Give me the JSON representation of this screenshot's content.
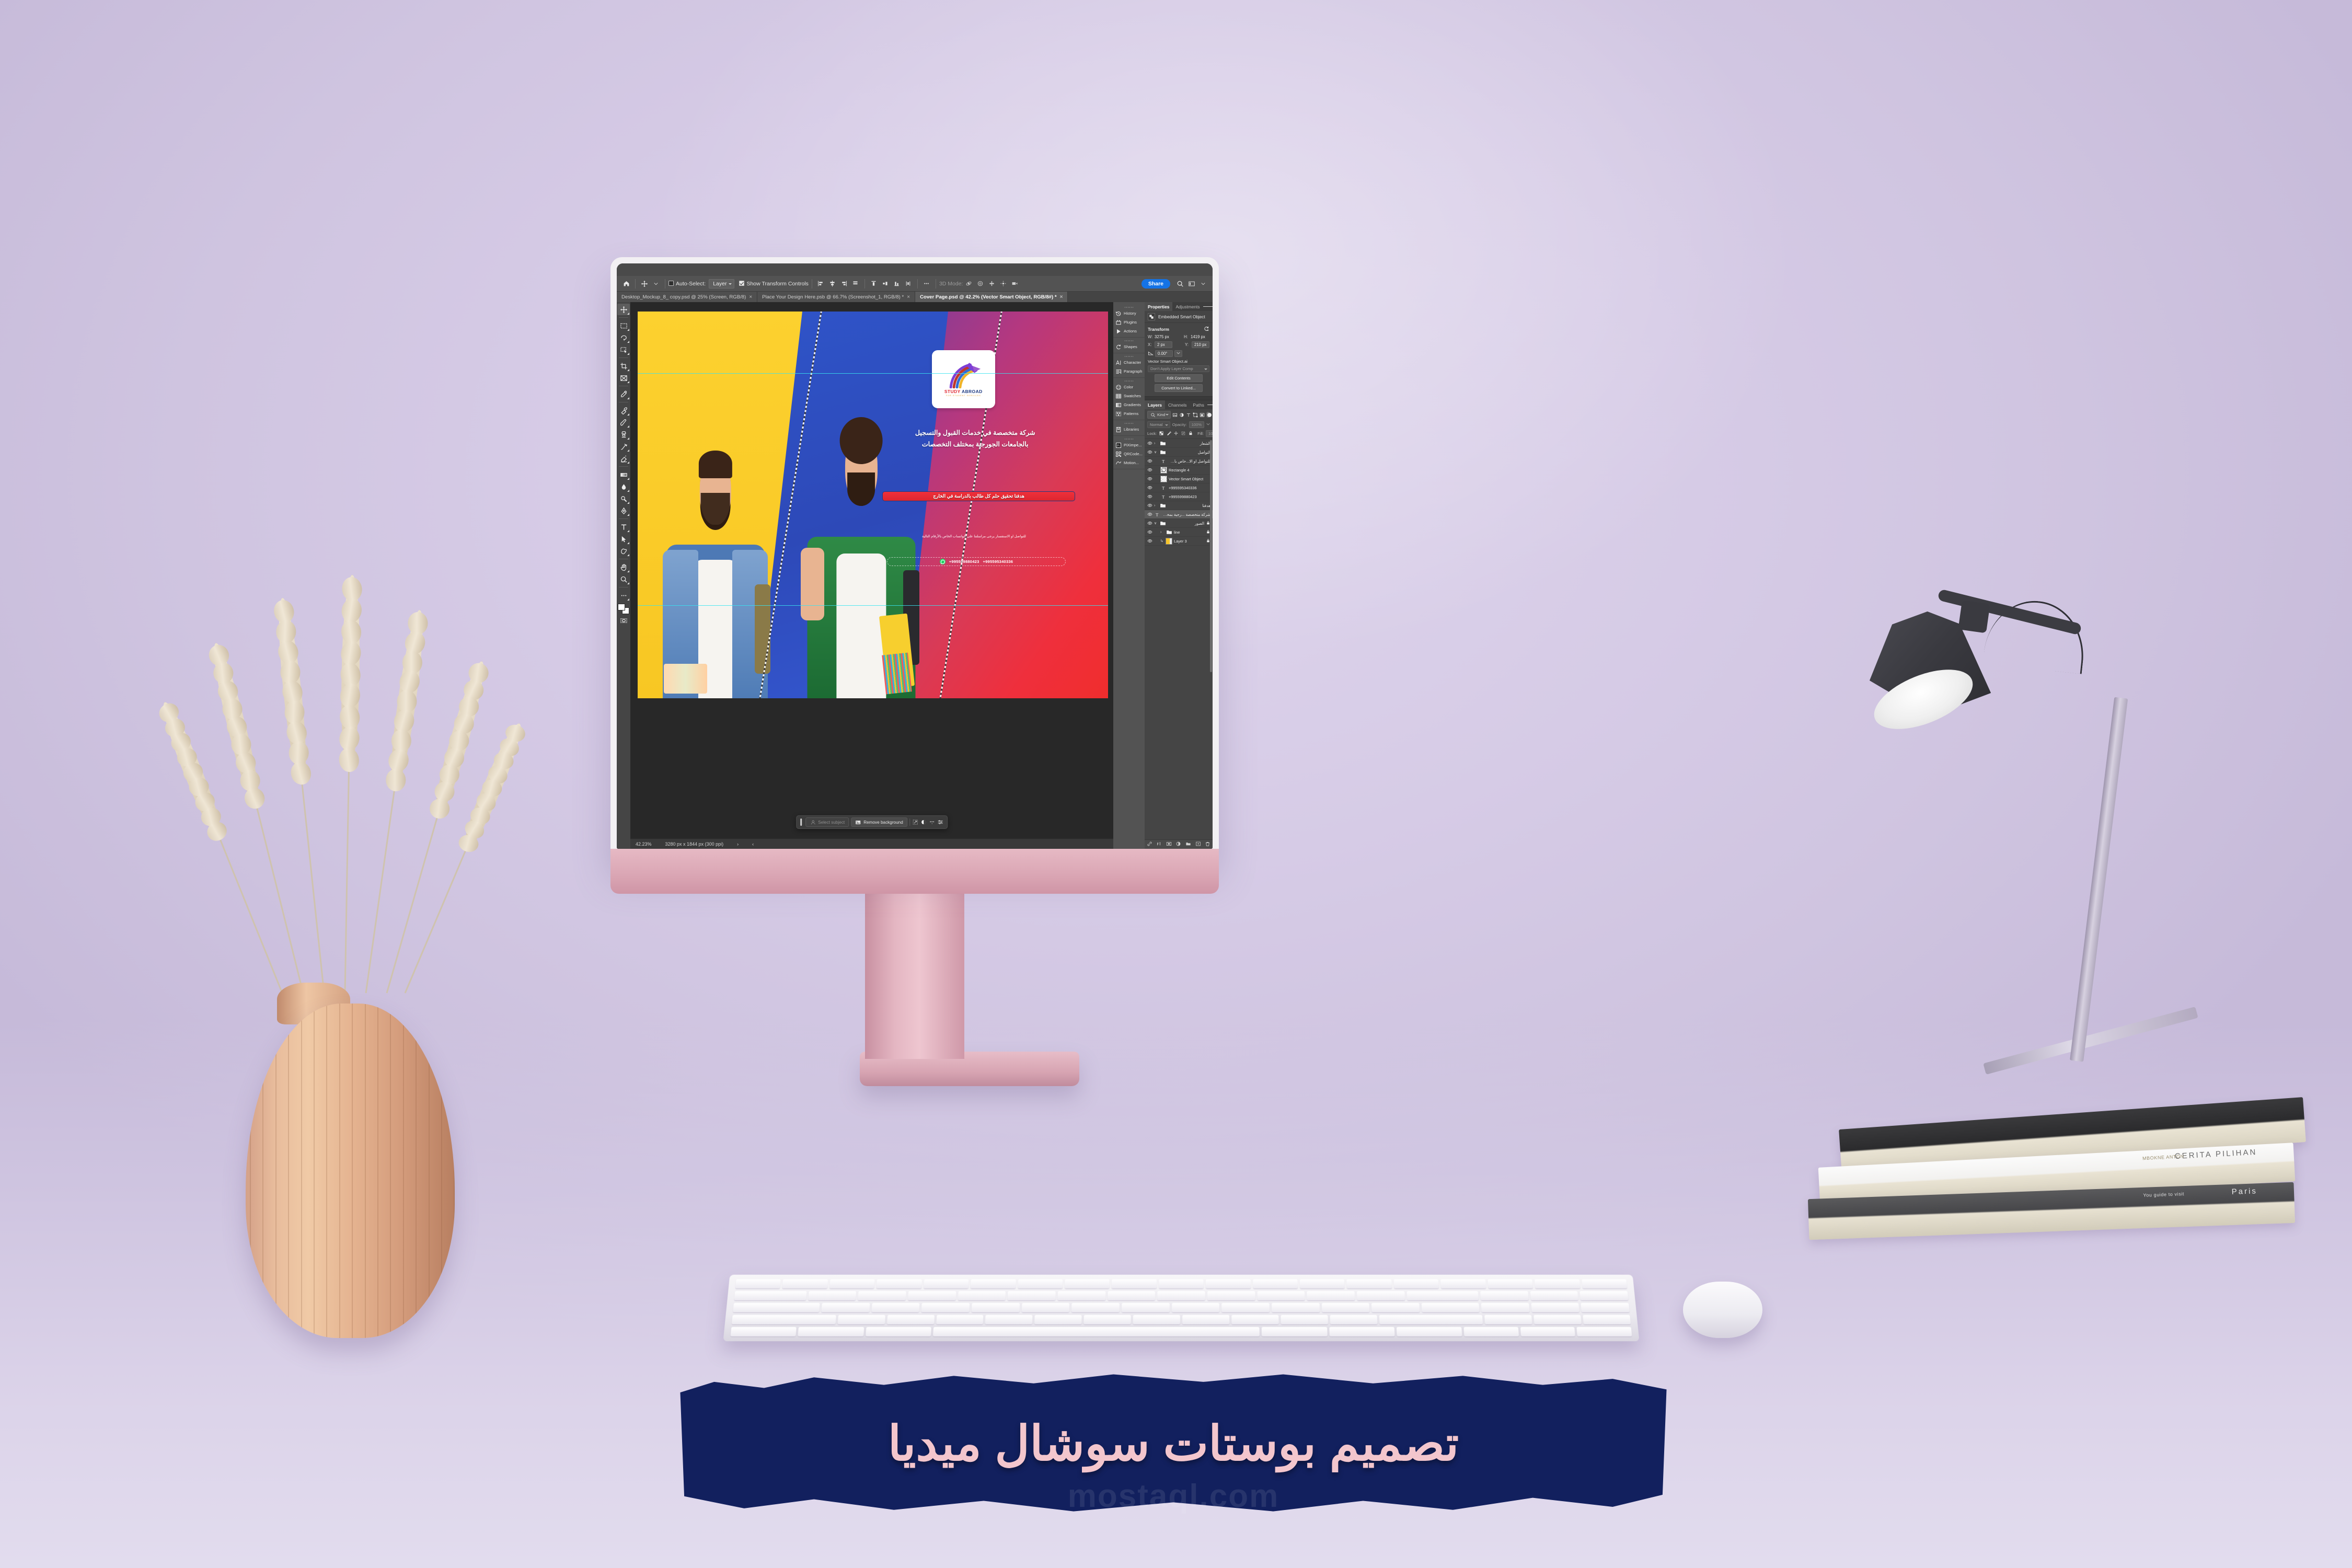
{
  "scene": {
    "background_color": "#d6cbe6",
    "description_objects": [
      "monitor",
      "keyboard",
      "mouse",
      "vase-with-wheat",
      "desk-lamp",
      "book-stack"
    ]
  },
  "app": {
    "name": "Adobe Photoshop",
    "share_label": "Share"
  },
  "options_bar": {
    "home_icon": "home-icon",
    "tool_icon": "move-tool-icon",
    "auto_select_label": "Auto-Select:",
    "auto_select_checked": false,
    "layer_select_value": "Layer",
    "show_transform_label": "Show Transform Controls",
    "show_transform_checked": true,
    "three_d_mode_label": "3D Mode:",
    "align_icons": [
      "align-left-edges-icon",
      "align-horizontal-centers-icon",
      "align-right-edges-icon",
      "align-top-edges-icon",
      "distribute-top-icon",
      "distribute-vertical-centers-icon",
      "distribute-bottom-icon",
      "distribute-horizontal-icon"
    ],
    "more_icon": "ellipsis-icon",
    "three_d_icons": [
      "orbit-3d-icon",
      "roll-3d-icon",
      "pan-3d-icon",
      "slide-3d-icon",
      "camera-3d-icon"
    ],
    "search_icon": "search-icon",
    "workspace_icon": "workspace-switcher-icon"
  },
  "document_tabs": [
    {
      "label": "Desktop_Mockup_8_ copy.psd @ 25% (Screen, RGB/8)",
      "active": false,
      "close": "×"
    },
    {
      "label": "Place Your Design Here.psb @ 66.7% (Screenshot_1, RGB/8) *",
      "active": false,
      "close": "×"
    },
    {
      "label": "Cover Page.psd @ 42.2% (Vector Smart Object, RGB/8#) *",
      "active": true,
      "close": "×"
    }
  ],
  "toolbar": {
    "tools": [
      {
        "name": "move-tool",
        "selected": true
      },
      {
        "name": "rectangular-marquee-tool",
        "selected": false
      },
      {
        "name": "lasso-tool",
        "selected": false
      },
      {
        "name": "object-selection-tool",
        "selected": false
      },
      {
        "name": "crop-tool",
        "selected": false
      },
      {
        "name": "frame-tool",
        "selected": false
      },
      {
        "name": "eyedropper-tool",
        "selected": false
      },
      {
        "name": "spot-healing-brush-tool",
        "selected": false
      },
      {
        "name": "brush-tool",
        "selected": false
      },
      {
        "name": "clone-stamp-tool",
        "selected": false
      },
      {
        "name": "history-brush-tool",
        "selected": false
      },
      {
        "name": "eraser-tool",
        "selected": false
      },
      {
        "name": "gradient-tool",
        "selected": false
      },
      {
        "name": "blur-tool",
        "selected": false
      },
      {
        "name": "dodge-tool",
        "selected": false
      },
      {
        "name": "pen-tool",
        "selected": false
      },
      {
        "name": "type-tool",
        "selected": false
      },
      {
        "name": "path-selection-tool",
        "selected": false
      },
      {
        "name": "shape-tool",
        "selected": false
      },
      {
        "name": "hand-tool",
        "selected": false
      },
      {
        "name": "zoom-tool",
        "selected": false
      },
      {
        "name": "edit-toolbar-tool",
        "selected": false
      }
    ],
    "foreground_color": "#ffffff",
    "background_color": "#ffffff",
    "quick_mask_label": "quick-mask-icon"
  },
  "canvas": {
    "poster": {
      "panel_colors": [
        "#fbcf2d",
        "#2f50c4",
        "#ef3040"
      ],
      "students": [
        "student-with-books",
        "student-with-notebooks"
      ],
      "logo": {
        "name": "STUDY ABROAD",
        "word_1": "STUDY",
        "word_2": "ABROAD",
        "tagline": "FOR STUDENT SERVICES",
        "word_1_color": "#e02a33",
        "word_2_color": "#1f3a80"
      },
      "headline_line_1": "شركة متخصصة في خدمات القبول والتسجيل",
      "headline_line_2": "بالجامعات الجورجية بمختلف التخصصات",
      "cta_button": "هدفنا تحقيق حلم كل طالب بالدراسة في الخارج",
      "cta_bg_color": "#e62b35",
      "cta_border_color": "#1f3a80",
      "contact_line": "للتواصل او الاستفسار يرجى مراسلتنا على الواتساب الخاص بالأرقام التالية",
      "whatsapp_icon": "whatsapp-icon",
      "phone_1": "+995599880423",
      "phone_2": "+995595340336"
    }
  },
  "contextual_taskbar": {
    "select_subject_label": "Select subject",
    "select_subject_icon": "person-select-icon",
    "remove_background_label": "Remove background",
    "remove_background_icon": "image-icon",
    "transform_icon": "transform-selection-icon",
    "adjustment_icon": "adjustment-layer-icon",
    "more_icon": "ellipsis-icon",
    "properties_icon": "sliders-icon"
  },
  "status_bar": {
    "zoom": "42.23%",
    "doc_size": "3280 px x 1844 px (300 ppi)",
    "next_arrow": "›",
    "prev_arrow": "‹"
  },
  "panel_rail": {
    "groups": [
      {
        "items": [
          {
            "label": "History",
            "icon": "history-icon"
          },
          {
            "label": "Plugins",
            "icon": "plugins-icon"
          },
          {
            "label": "Actions",
            "icon": "actions-play-icon"
          }
        ]
      },
      {
        "items": [
          {
            "label": "Shapes",
            "icon": "shapes-icon"
          }
        ]
      },
      {
        "items": [
          {
            "label": "Character",
            "icon": "character-icon"
          },
          {
            "label": "Paragraph",
            "icon": "paragraph-icon"
          }
        ]
      },
      {
        "items": [
          {
            "label": "Color",
            "icon": "color-wheel-icon"
          },
          {
            "label": "Swatches",
            "icon": "swatches-icon"
          },
          {
            "label": "Gradients",
            "icon": "gradients-icon"
          },
          {
            "label": "Patterns",
            "icon": "patterns-icon"
          }
        ]
      },
      {
        "items": [
          {
            "label": "Libraries",
            "icon": "libraries-icon"
          }
        ]
      },
      {
        "items": [
          {
            "label": "PiXimpe...",
            "icon": "piximperfect-icon"
          },
          {
            "label": "QRCode...",
            "icon": "qrcode-icon"
          },
          {
            "label": "Motion...",
            "icon": "motion-icon"
          }
        ]
      }
    ]
  },
  "properties_panel": {
    "tabs": [
      {
        "label": "Properties",
        "active": true
      },
      {
        "label": "Adjustments",
        "active": false
      }
    ],
    "object_type": "Embedded Smart Object",
    "object_icon": "smart-object-icon",
    "transform_title": "Transform",
    "reset_icon": "reset-icon",
    "w_label": "W:",
    "w_value": "3275 px",
    "h_label": "H:",
    "h_value": "1419 px",
    "x_label": "X:",
    "x_value": "2 px",
    "y_label": "Y:",
    "y_value": "210 px",
    "angle_icon": "angle-icon",
    "angle_value": "0.00°",
    "source_file": "Vector Smart Object.ai",
    "layer_comp_value": "Don't Apply Layer Comp",
    "edit_contents_label": "Edit Contents",
    "convert_to_linked_label": "Convert to Linked..."
  },
  "layers_panel": {
    "tabs": [
      {
        "label": "Layers",
        "active": true
      },
      {
        "label": "Channels",
        "active": false
      },
      {
        "label": "Paths",
        "active": false
      }
    ],
    "filter_label": "Kind",
    "filter_icon": "search-icon",
    "filter_type_icons": [
      "pixel-filter-icon",
      "adjustment-filter-icon",
      "type-filter-icon",
      "shape-filter-icon",
      "smart-object-filter-icon"
    ],
    "filter_toggle": "filter-enable-toggle",
    "blend_mode": "Normal",
    "opacity_label": "Opacity:",
    "opacity_value": "100%",
    "lock_label": "Lock:",
    "lock_icons": [
      "lock-transparency-icon",
      "lock-image-icon",
      "lock-position-icon",
      "lock-artboard-icon",
      "lock-all-icon"
    ],
    "fill_label": "Fill:",
    "fill_value": "100%",
    "rows": [
      {
        "name": "الشعار",
        "type": "group",
        "rtl": true,
        "expanded": false,
        "indent": 0,
        "locked": false,
        "selected": false
      },
      {
        "name": "التواصل",
        "type": "group",
        "rtl": true,
        "expanded": true,
        "indent": 0,
        "locked": false,
        "selected": false
      },
      {
        "name": "للتواصل او الا...خاص بالأرقام",
        "type": "text",
        "rtl": true,
        "indent": 1,
        "locked": false,
        "selected": false
      },
      {
        "name": "Rectangle 4",
        "type": "shape",
        "rtl": false,
        "indent": 1,
        "locked": false,
        "selected": false
      },
      {
        "name": "Vector Smart Object",
        "type": "smart",
        "rtl": false,
        "indent": 1,
        "locked": false,
        "selected": false
      },
      {
        "name": "+995595340336",
        "type": "text",
        "rtl": false,
        "indent": 1,
        "locked": false,
        "selected": false
      },
      {
        "name": "+995599880423",
        "type": "text",
        "rtl": false,
        "indent": 1,
        "locked": false,
        "selected": false
      },
      {
        "name": "هدفنا",
        "type": "group",
        "rtl": true,
        "expanded": false,
        "indent": 0,
        "locked": false,
        "selected": false
      },
      {
        "name": "شركة متخصصة ...رجية بمختلف",
        "type": "text",
        "rtl": true,
        "indent": 0,
        "locked": false,
        "selected": true
      },
      {
        "name": "الصور",
        "type": "group",
        "rtl": true,
        "expanded": true,
        "indent": 0,
        "locked": true,
        "selected": false
      },
      {
        "name": "line",
        "type": "group",
        "rtl": false,
        "expanded": false,
        "indent": 1,
        "locked": true,
        "selected": false
      },
      {
        "name": "Layer 3",
        "type": "image",
        "rtl": false,
        "indent": 1,
        "locked": true,
        "selected": false
      }
    ],
    "footer_icons": [
      "link-layers-icon",
      "layer-style-fx-icon",
      "layer-mask-icon",
      "new-adjustment-layer-icon",
      "new-group-icon",
      "new-layer-icon",
      "delete-layer-icon"
    ]
  },
  "banner": {
    "headline": "تصميم بوستات سوشال ميديا",
    "watermark": "mostaql.com",
    "ink_color": "#12205e",
    "text_color": "#f3c6cd"
  },
  "books": [
    {
      "title": "CERITA PILIHAN",
      "author": "MBOKNE ANTON"
    },
    {
      "title": "Paris",
      "subtitle": "You guide to visit"
    }
  ]
}
